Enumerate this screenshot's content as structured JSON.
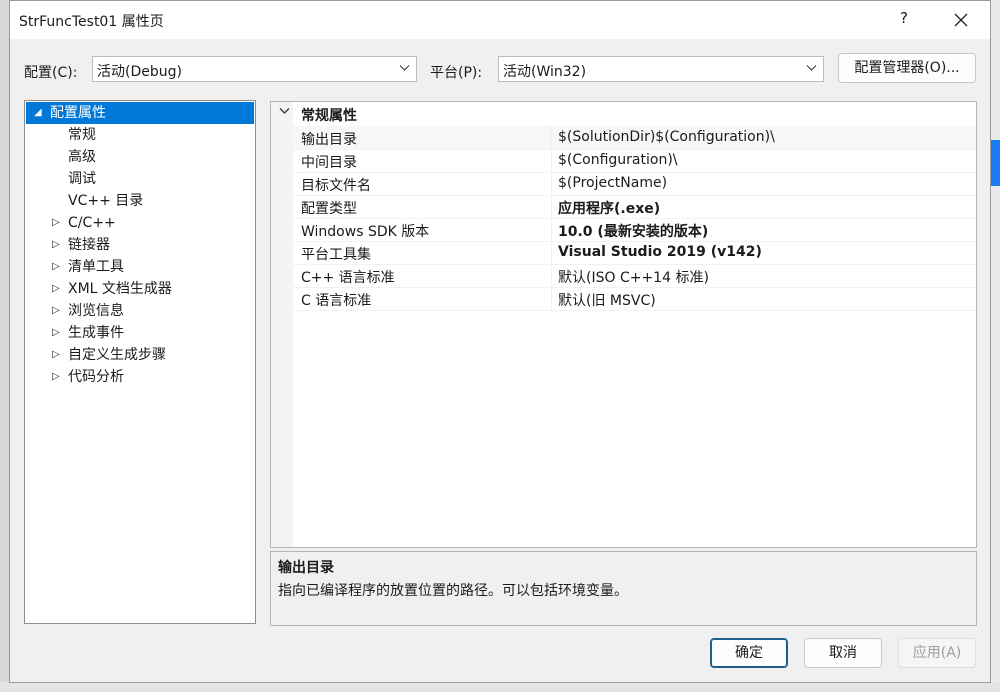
{
  "window": {
    "title": "StrFuncTest01 属性页",
    "help_label": "?"
  },
  "config_bar": {
    "config_label": "配置(C):",
    "config_value": "活动(Debug)",
    "platform_label": "平台(P):",
    "platform_value": "活动(Win32)",
    "config_manager_label": "配置管理器(O)..."
  },
  "tree": {
    "items": [
      {
        "label": "配置属性",
        "arrow": "◢"
      },
      {
        "label": "常规",
        "arrow": ""
      },
      {
        "label": "高级",
        "arrow": ""
      },
      {
        "label": "调试",
        "arrow": ""
      },
      {
        "label": "VC++ 目录",
        "arrow": ""
      },
      {
        "label": "C/C++",
        "arrow": "▷"
      },
      {
        "label": "链接器",
        "arrow": "▷"
      },
      {
        "label": "清单工具",
        "arrow": "▷"
      },
      {
        "label": "XML 文档生成器",
        "arrow": "▷"
      },
      {
        "label": "浏览信息",
        "arrow": "▷"
      },
      {
        "label": "生成事件",
        "arrow": "▷"
      },
      {
        "label": "自定义生成步骤",
        "arrow": "▷"
      },
      {
        "label": "代码分析",
        "arrow": "▷"
      }
    ]
  },
  "grid": {
    "category": "常规属性",
    "rows": [
      {
        "name": "输出目录",
        "value": "$(SolutionDir)$(Configuration)\\"
      },
      {
        "name": "中间目录",
        "value": "$(Configuration)\\"
      },
      {
        "name": "目标文件名",
        "value": "$(ProjectName)"
      },
      {
        "name": "配置类型",
        "value": "应用程序(.exe)"
      },
      {
        "name": "Windows SDK 版本",
        "value": "10.0 (最新安装的版本)"
      },
      {
        "name": "平台工具集",
        "value": "Visual Studio 2019 (v142)"
      },
      {
        "name": "C++ 语言标准",
        "value": "默认(ISO C++14 标准)"
      },
      {
        "name": "C 语言标准",
        "value": "默认(旧 MSVC)"
      }
    ]
  },
  "description": {
    "title": "输出目录",
    "text": "指向已编译程序的放置位置的路径。可以包括环境变量。"
  },
  "buttons": {
    "ok": "确定",
    "cancel": "取消",
    "apply": "应用(A)"
  },
  "colors": {
    "selection": "#0078d7",
    "primary_border": "#1f5e8c"
  }
}
